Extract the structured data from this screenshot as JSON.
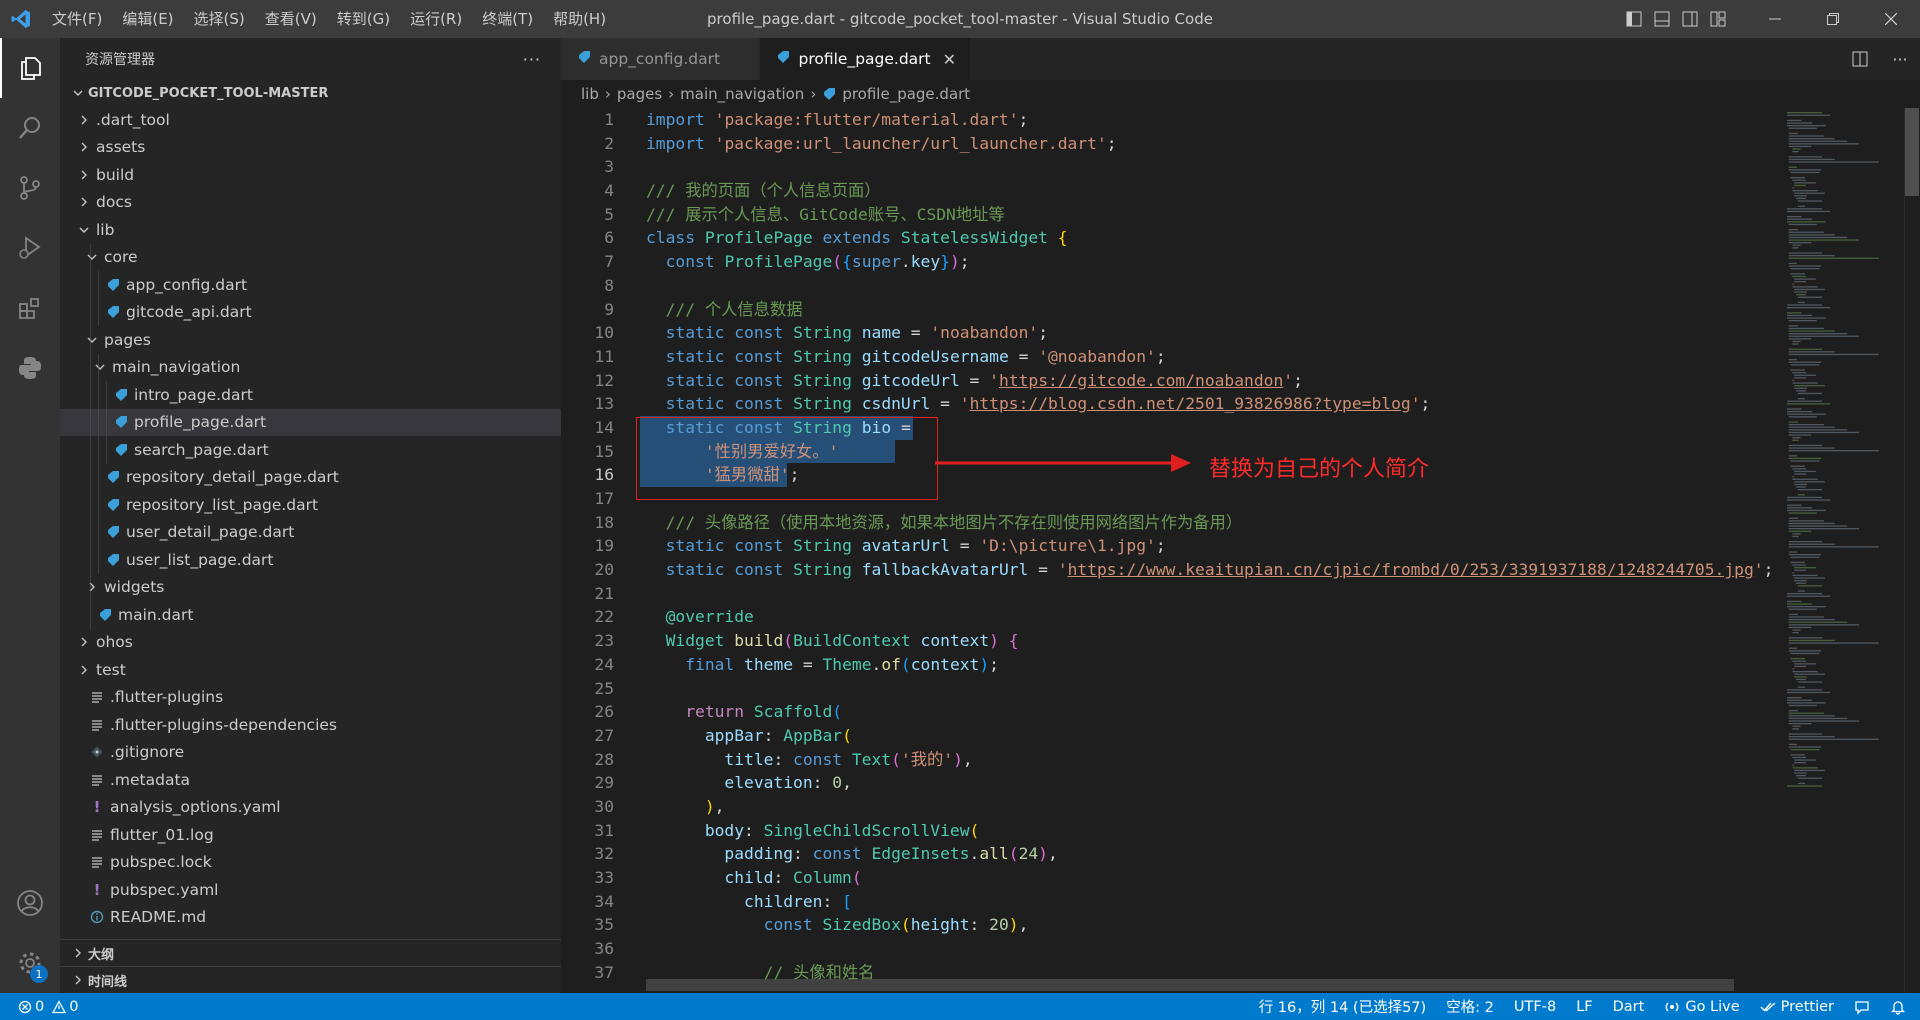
{
  "window": {
    "title": "profile_page.dart - gitcode_pocket_tool-master - Visual Studio Code",
    "menu": [
      "文件(F)",
      "编辑(E)",
      "选择(S)",
      "查看(V)",
      "转到(G)",
      "运行(R)",
      "终端(T)",
      "帮助(H)"
    ]
  },
  "activity": {
    "badge": "1"
  },
  "sidebar": {
    "title": "资源管理器",
    "more": "···",
    "root": "GITCODE_POCKET_TOOL-MASTER",
    "tree": [
      {
        "label": ".dart_tool",
        "kind": "folder",
        "open": false,
        "depth": 1
      },
      {
        "label": "assets",
        "kind": "folder",
        "open": false,
        "depth": 1
      },
      {
        "label": "build",
        "kind": "folder",
        "open": false,
        "depth": 1
      },
      {
        "label": "docs",
        "kind": "folder",
        "open": false,
        "depth": 1
      },
      {
        "label": "lib",
        "kind": "folder",
        "open": true,
        "depth": 1
      },
      {
        "label": "core",
        "kind": "folder",
        "open": true,
        "depth": 2
      },
      {
        "label": "app_config.dart",
        "kind": "dart",
        "depth": 3
      },
      {
        "label": "gitcode_api.dart",
        "kind": "dart",
        "depth": 3
      },
      {
        "label": "pages",
        "kind": "folder",
        "open": true,
        "depth": 2
      },
      {
        "label": "main_navigation",
        "kind": "folder",
        "open": true,
        "depth": 3
      },
      {
        "label": "intro_page.dart",
        "kind": "dart",
        "depth": 4
      },
      {
        "label": "profile_page.dart",
        "kind": "dart",
        "depth": 4,
        "selected": true
      },
      {
        "label": "search_page.dart",
        "kind": "dart",
        "depth": 4
      },
      {
        "label": "repository_detail_page.dart",
        "kind": "dart",
        "depth": 3
      },
      {
        "label": "repository_list_page.dart",
        "kind": "dart",
        "depth": 3
      },
      {
        "label": "user_detail_page.dart",
        "kind": "dart",
        "depth": 3
      },
      {
        "label": "user_list_page.dart",
        "kind": "dart",
        "depth": 3
      },
      {
        "label": "widgets",
        "kind": "folder",
        "open": false,
        "depth": 2
      },
      {
        "label": "main.dart",
        "kind": "dart",
        "depth": 2
      },
      {
        "label": "ohos",
        "kind": "folder",
        "open": false,
        "depth": 1
      },
      {
        "label": "test",
        "kind": "folder",
        "open": false,
        "depth": 1
      },
      {
        "label": ".flutter-plugins",
        "kind": "lines",
        "depth": 1
      },
      {
        "label": ".flutter-plugins-dependencies",
        "kind": "lines",
        "depth": 1
      },
      {
        "label": ".gitignore",
        "kind": "git",
        "depth": 1
      },
      {
        "label": ".metadata",
        "kind": "lines",
        "depth": 1
      },
      {
        "label": "analysis_options.yaml",
        "kind": "yaml",
        "depth": 1
      },
      {
        "label": "flutter_01.log",
        "kind": "lines",
        "depth": 1
      },
      {
        "label": "pubspec.lock",
        "kind": "lines",
        "depth": 1
      },
      {
        "label": "pubspec.yaml",
        "kind": "yaml",
        "depth": 1
      },
      {
        "label": "README.md",
        "kind": "info",
        "depth": 1
      }
    ],
    "sections": [
      "大纲",
      "时间线"
    ]
  },
  "tabs": [
    {
      "label": "app_config.dart",
      "active": false
    },
    {
      "label": "profile_page.dart",
      "active": true
    }
  ],
  "breadcrumb": [
    "lib",
    "pages",
    "main_navigation",
    "profile_page.dart"
  ],
  "editor": {
    "current_line": 16,
    "lines": [
      [
        [
          "kw",
          "import"
        ],
        [
          "pu",
          " "
        ],
        [
          "str",
          "'package:flutter/material.dart'"
        ],
        [
          "pu",
          ";"
        ]
      ],
      [
        [
          "kw",
          "import"
        ],
        [
          "pu",
          " "
        ],
        [
          "str",
          "'package:url_launcher/url_launcher.dart'"
        ],
        [
          "pu",
          ";"
        ]
      ],
      [],
      [
        [
          "cm",
          "/// 我的页面（个人信息页面）"
        ]
      ],
      [
        [
          "cm",
          "/// 展示个人信息、GitCode账号、CSDN地址等"
        ]
      ],
      [
        [
          "kw",
          "class"
        ],
        [
          "pu",
          " "
        ],
        [
          "ty",
          "ProfilePage"
        ],
        [
          "pu",
          " "
        ],
        [
          "kw",
          "extends"
        ],
        [
          "pu",
          " "
        ],
        [
          "ty",
          "StatelessWidget"
        ],
        [
          "pu",
          " "
        ],
        [
          "br1",
          "{"
        ]
      ],
      [
        [
          "pu",
          "  "
        ],
        [
          "kw",
          "const"
        ],
        [
          "pu",
          " "
        ],
        [
          "ty",
          "ProfilePage"
        ],
        [
          "br2",
          "("
        ],
        [
          "br3",
          "{"
        ],
        [
          "kw",
          "super"
        ],
        [
          "pu",
          "."
        ],
        [
          "vr",
          "key"
        ],
        [
          "br3",
          "}"
        ],
        [
          "br2",
          ")"
        ],
        [
          "pu",
          ";"
        ]
      ],
      [],
      [
        [
          "pu",
          "  "
        ],
        [
          "cm",
          "/// 个人信息数据"
        ]
      ],
      [
        [
          "pu",
          "  "
        ],
        [
          "kw",
          "static"
        ],
        [
          "pu",
          " "
        ],
        [
          "kw",
          "const"
        ],
        [
          "pu",
          " "
        ],
        [
          "ty",
          "String"
        ],
        [
          "pu",
          " "
        ],
        [
          "vr",
          "name"
        ],
        [
          "pu",
          " = "
        ],
        [
          "str",
          "'noabandon'"
        ],
        [
          "pu",
          ";"
        ]
      ],
      [
        [
          "pu",
          "  "
        ],
        [
          "kw",
          "static"
        ],
        [
          "pu",
          " "
        ],
        [
          "kw",
          "const"
        ],
        [
          "pu",
          " "
        ],
        [
          "ty",
          "String"
        ],
        [
          "pu",
          " "
        ],
        [
          "vr",
          "gitcodeUsername"
        ],
        [
          "pu",
          " = "
        ],
        [
          "str",
          "'@noabandon'"
        ],
        [
          "pu",
          ";"
        ]
      ],
      [
        [
          "pu",
          "  "
        ],
        [
          "kw",
          "static"
        ],
        [
          "pu",
          " "
        ],
        [
          "kw",
          "const"
        ],
        [
          "pu",
          " "
        ],
        [
          "ty",
          "String"
        ],
        [
          "pu",
          " "
        ],
        [
          "vr",
          "gitcodeUrl"
        ],
        [
          "pu",
          " = "
        ],
        [
          "str",
          "'"
        ],
        [
          "str url",
          "https://gitcode.com/noabandon"
        ],
        [
          "str",
          "'"
        ],
        [
          "pu",
          ";"
        ]
      ],
      [
        [
          "pu",
          "  "
        ],
        [
          "kw",
          "static"
        ],
        [
          "pu",
          " "
        ],
        [
          "kw",
          "const"
        ],
        [
          "pu",
          " "
        ],
        [
          "ty",
          "String"
        ],
        [
          "pu",
          " "
        ],
        [
          "vr",
          "csdnUrl"
        ],
        [
          "pu",
          " = "
        ],
        [
          "str",
          "'"
        ],
        [
          "str url",
          "https://blog.csdn.net/2501_93826986?type=blog"
        ],
        [
          "str",
          "'"
        ],
        [
          "pu",
          ";"
        ]
      ],
      [
        [
          "pu",
          "  "
        ],
        [
          "kw",
          "static"
        ],
        [
          "pu",
          " "
        ],
        [
          "kw",
          "const"
        ],
        [
          "pu",
          " "
        ],
        [
          "ty",
          "String"
        ],
        [
          "pu",
          " "
        ],
        [
          "vr",
          "bio"
        ],
        [
          "pu",
          " ="
        ]
      ],
      [
        [
          "pu",
          "      "
        ],
        [
          "str",
          "'性别男爱好女。'"
        ]
      ],
      [
        [
          "pu",
          "      "
        ],
        [
          "str",
          "'猛男微甜'"
        ],
        [
          "pu",
          ";"
        ]
      ],
      [],
      [
        [
          "pu",
          "  "
        ],
        [
          "cm",
          "/// 头像路径（使用本地资源，如果本地图片不存在则使用网络图片作为备用）"
        ]
      ],
      [
        [
          "pu",
          "  "
        ],
        [
          "kw",
          "static"
        ],
        [
          "pu",
          " "
        ],
        [
          "kw",
          "const"
        ],
        [
          "pu",
          " "
        ],
        [
          "ty",
          "String"
        ],
        [
          "pu",
          " "
        ],
        [
          "vr",
          "avatarUrl"
        ],
        [
          "pu",
          " = "
        ],
        [
          "str",
          "'D:\\picture\\1.jpg'"
        ],
        [
          "pu",
          ";"
        ]
      ],
      [
        [
          "pu",
          "  "
        ],
        [
          "kw",
          "static"
        ],
        [
          "pu",
          " "
        ],
        [
          "kw",
          "const"
        ],
        [
          "pu",
          " "
        ],
        [
          "ty",
          "String"
        ],
        [
          "pu",
          " "
        ],
        [
          "vr",
          "fallbackAvatarUrl"
        ],
        [
          "pu",
          " = "
        ],
        [
          "str",
          "'"
        ],
        [
          "str url",
          "https://www.keaitupian.cn/cjpic/frombd/0/253/3391937188/1248244705.jpg"
        ],
        [
          "str",
          "'"
        ],
        [
          "pu",
          ";"
        ]
      ],
      [],
      [
        [
          "pu",
          "  "
        ],
        [
          "ty",
          "@override"
        ]
      ],
      [
        [
          "pu",
          "  "
        ],
        [
          "ty",
          "Widget"
        ],
        [
          "pu",
          " "
        ],
        [
          "fn",
          "build"
        ],
        [
          "br2",
          "("
        ],
        [
          "ty",
          "BuildContext"
        ],
        [
          "pu",
          " "
        ],
        [
          "vr",
          "context"
        ],
        [
          "br2",
          ")"
        ],
        [
          "pu",
          " "
        ],
        [
          "br2",
          "{"
        ]
      ],
      [
        [
          "pu",
          "    "
        ],
        [
          "kw",
          "final"
        ],
        [
          "pu",
          " "
        ],
        [
          "vr",
          "theme"
        ],
        [
          "pu",
          " = "
        ],
        [
          "ty",
          "Theme"
        ],
        [
          "pu",
          "."
        ],
        [
          "fn",
          "of"
        ],
        [
          "br3",
          "("
        ],
        [
          "vr",
          "context"
        ],
        [
          "br3",
          ")"
        ],
        [
          "pu",
          ";"
        ]
      ],
      [],
      [
        [
          "pu",
          "    "
        ],
        [
          "ctl",
          "return"
        ],
        [
          "pu",
          " "
        ],
        [
          "ty",
          "Scaffold"
        ],
        [
          "br3",
          "("
        ]
      ],
      [
        [
          "pu",
          "      "
        ],
        [
          "vr",
          "appBar"
        ],
        [
          "pu",
          ": "
        ],
        [
          "ty",
          "AppBar"
        ],
        [
          "br1",
          "("
        ]
      ],
      [
        [
          "pu",
          "        "
        ],
        [
          "vr",
          "title"
        ],
        [
          "pu",
          ": "
        ],
        [
          "kw",
          "const"
        ],
        [
          "pu",
          " "
        ],
        [
          "ty",
          "Text"
        ],
        [
          "br2",
          "("
        ],
        [
          "str",
          "'我的'"
        ],
        [
          "br2",
          ")"
        ],
        [
          "pu",
          ","
        ]
      ],
      [
        [
          "pu",
          "        "
        ],
        [
          "vr",
          "elevation"
        ],
        [
          "pu",
          ": "
        ],
        [
          "num",
          "0"
        ],
        [
          "pu",
          ","
        ]
      ],
      [
        [
          "pu",
          "      "
        ],
        [
          "br1",
          ")"
        ],
        [
          "pu",
          ","
        ]
      ],
      [
        [
          "pu",
          "      "
        ],
        [
          "vr",
          "body"
        ],
        [
          "pu",
          ": "
        ],
        [
          "ty",
          "SingleChildScrollView"
        ],
        [
          "br1",
          "("
        ]
      ],
      [
        [
          "pu",
          "        "
        ],
        [
          "vr",
          "padding"
        ],
        [
          "pu",
          ": "
        ],
        [
          "kw",
          "const"
        ],
        [
          "pu",
          " "
        ],
        [
          "ty",
          "EdgeInsets"
        ],
        [
          "pu",
          "."
        ],
        [
          "fn",
          "all"
        ],
        [
          "br2",
          "("
        ],
        [
          "num",
          "24"
        ],
        [
          "br2",
          ")"
        ],
        [
          "pu",
          ","
        ]
      ],
      [
        [
          "pu",
          "        "
        ],
        [
          "vr",
          "child"
        ],
        [
          "pu",
          ": "
        ],
        [
          "ty",
          "Column"
        ],
        [
          "br2",
          "("
        ]
      ],
      [
        [
          "pu",
          "          "
        ],
        [
          "vr",
          "children"
        ],
        [
          "pu",
          ": "
        ],
        [
          "br3",
          "["
        ]
      ],
      [
        [
          "pu",
          "            "
        ],
        [
          "kw",
          "const"
        ],
        [
          "pu",
          " "
        ],
        [
          "ty",
          "SizedBox"
        ],
        [
          "br1",
          "("
        ],
        [
          "vr",
          "height"
        ],
        [
          "pu",
          ": "
        ],
        [
          "num",
          "20"
        ],
        [
          "br1",
          ")"
        ],
        [
          "pu",
          ","
        ]
      ],
      [],
      [
        [
          "pu",
          "            "
        ],
        [
          "cm",
          "// 头像和姓名"
        ]
      ]
    ]
  },
  "annotation": {
    "text": "替换为自己的个人简介"
  },
  "status": {
    "errors": "0",
    "warnings": "0",
    "position": "行 16，列 14 (已选择57)",
    "spaces": "空格: 2",
    "encoding": "UTF-8",
    "eol": "LF",
    "language": "Dart",
    "golive": "Go Live",
    "prettier": "Prettier"
  },
  "colors": {
    "accent": "#007acc",
    "annotation": "#ff2a2a",
    "selection": "#264f78"
  }
}
